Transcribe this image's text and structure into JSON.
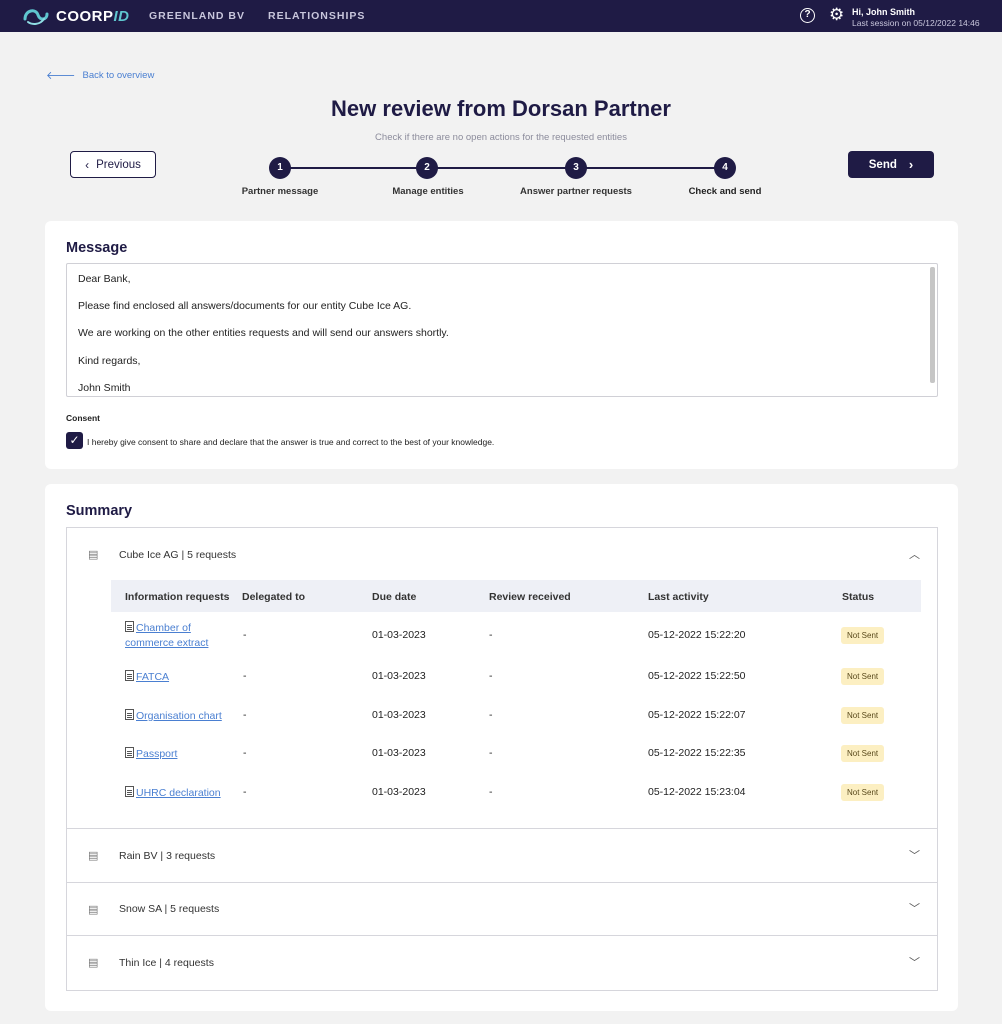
{
  "header": {
    "brand_main": "COORP",
    "brand_accent": "ID",
    "nav": [
      "GREENLAND BV",
      "RELATIONSHIPS"
    ],
    "help_icon": "help-circle-icon",
    "settings_icon": "gear-icon",
    "greeting": "Hi, John Smith",
    "last_session": "Last session on  05/12/2022 14:46",
    "colors": {
      "bar": "#1f1b45",
      "brand_accent": "#5fc6cf"
    }
  },
  "back_link": "Back to overview",
  "title": "New review from Dorsan Partner",
  "subtitle": "Check if there are no open actions for the requested entities",
  "buttons": {
    "previous": "Previous",
    "send": "Send"
  },
  "steps": [
    {
      "num": "1",
      "label": "Partner message"
    },
    {
      "num": "2",
      "label": "Manage entities"
    },
    {
      "num": "3",
      "label": "Answer partner requests"
    },
    {
      "num": "4",
      "label": "Check and send"
    }
  ],
  "message": {
    "title": "Message",
    "lines": [
      "Dear Bank,",
      "Please find enclosed all answers/documents for our entity Cube Ice AG.",
      "We are working on the other entities requests and will send our answers shortly.",
      "Kind regards,",
      "John Smith"
    ],
    "consent_label": "Consent",
    "consent_checked": true,
    "consent_text": "I hereby give consent to share and declare that the answer is true and correct to the best of your knowledge."
  },
  "summary": {
    "title": "Summary",
    "columns": [
      "Information requests",
      "Delegated to",
      "Due date",
      "Review received",
      "Last activity",
      "Status"
    ],
    "entities": [
      {
        "label": "Cube Ice AG | 5 requests",
        "expanded": true,
        "rows": [
          {
            "request_l1": "Chamber of ",
            "request_l2": "commerce extract",
            "delegated": "-",
            "due": "01-03-2023",
            "review": "-",
            "activity": "05-12-2022 15:22:20",
            "status": "Not Sent"
          },
          {
            "request_l1": "FATCA",
            "request_l2": "",
            "delegated": "-",
            "due": "01-03-2023",
            "review": "-",
            "activity": "05-12-2022 15:22:50",
            "status": "Not Sent"
          },
          {
            "request_l1": "Organisation chart",
            "request_l2": "",
            "delegated": "-",
            "due": "01-03-2023",
            "review": "-",
            "activity": "05-12-2022 15:22:07",
            "status": "Not Sent"
          },
          {
            "request_l1": "Passport",
            "request_l2": "",
            "delegated": "-",
            "due": "01-03-2023",
            "review": "-",
            "activity": "05-12-2022 15:22:35",
            "status": "Not Sent"
          },
          {
            "request_l1": "UHRC declaration",
            "request_l2": "",
            "delegated": "-",
            "due": "01-03-2023",
            "review": "-",
            "activity": "05-12-2022 15:23:04",
            "status": "Not Sent"
          }
        ]
      },
      {
        "label": "Rain BV | 3 requests",
        "expanded": false
      },
      {
        "label": "Snow SA | 5 requests",
        "expanded": false
      },
      {
        "label": "Thin Ice | 4 requests",
        "expanded": false
      }
    ],
    "status_color": "#fcefc2"
  }
}
